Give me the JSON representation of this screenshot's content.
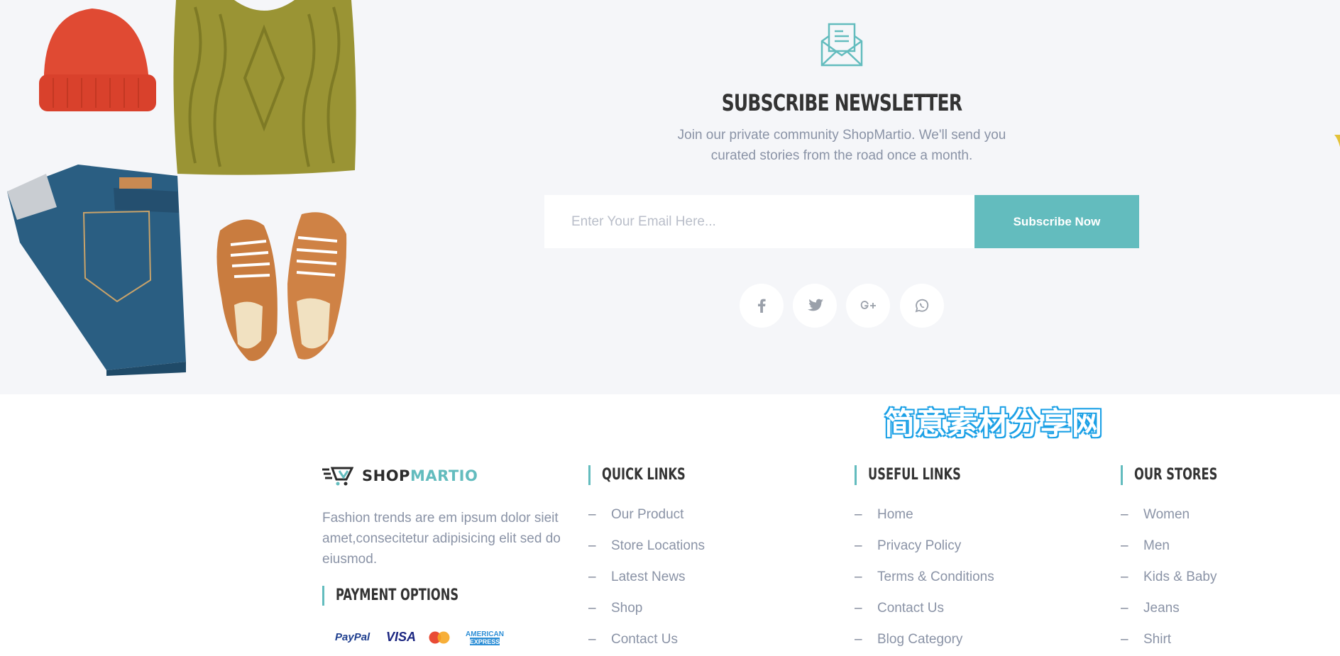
{
  "newsletter": {
    "title": "SUBSCRIBE NEWSLETTER",
    "description_line1": "Join our private community ShopMartio. We'll send you",
    "description_line2": "curated stories from the road once a month.",
    "email_placeholder": "Enter Your Email Here...",
    "subscribe_label": "Subscribe Now",
    "social": [
      "facebook-icon",
      "twitter-icon",
      "google-plus-icon",
      "whatsapp-icon"
    ]
  },
  "footer": {
    "brand_part1": "SHOP",
    "brand_part2": "MARTIO",
    "about": "Fashion trends are em ipsum dolor sieit amet,consecitetur adipisicing elit sed do eiusmod.",
    "payment_title": "PAYMENT OPTIONS",
    "payments": {
      "paypal": "PayPal",
      "visa": "VISA",
      "amex_line1": "AMERICAN",
      "amex_line2": "EXPRESS"
    },
    "quick_links": {
      "title": "QUICK LINKS",
      "items": [
        "Our Product",
        "Store Locations",
        "Latest News",
        "Shop",
        "Contact Us"
      ]
    },
    "useful_links": {
      "title": "USEFUL LINKS",
      "items": [
        "Home",
        "Privacy Policy",
        "Terms & Conditions",
        "Contact Us",
        "Blog Category"
      ]
    },
    "our_stores": {
      "title": "OUR STORES",
      "items": [
        "Women",
        "Men",
        "Kids & Baby",
        "Jeans",
        "Shirt"
      ]
    }
  },
  "watermark": "简意素材分享网",
  "colors": {
    "accent": "#63bcbe",
    "section_bg": "#f5f6f9",
    "text_muted": "#8a93a6",
    "heading": "#333333"
  }
}
